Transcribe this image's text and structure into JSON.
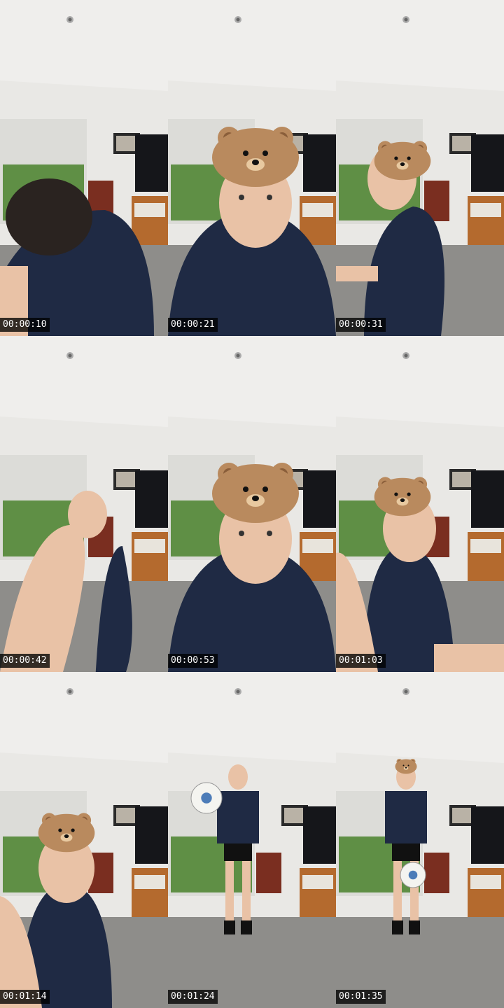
{
  "frames": [
    {
      "timestamp": "00:00:10",
      "filter": false,
      "pose": "bending"
    },
    {
      "timestamp": "00:00:21",
      "filter": true,
      "pose": "closeup"
    },
    {
      "timestamp": "00:00:31",
      "filter": true,
      "pose": "side"
    },
    {
      "timestamp": "00:00:42",
      "filter": false,
      "pose": "leg"
    },
    {
      "timestamp": "00:00:53",
      "filter": true,
      "pose": "closeup"
    },
    {
      "timestamp": "00:01:03",
      "filter": true,
      "pose": "sitting"
    },
    {
      "timestamp": "00:01:14",
      "filter": true,
      "pose": "sitting-low"
    },
    {
      "timestamp": "00:01:24",
      "filter": false,
      "pose": "juggling"
    },
    {
      "timestamp": "00:01:35",
      "filter": true,
      "pose": "juggling"
    }
  ],
  "colors": {
    "ceiling": "#efeeec",
    "wall": "#e9e8e5",
    "floor": "#8e8d8a",
    "shirt": "#1f2a44",
    "skin": "#e9c2a6",
    "hair": "#2a2320",
    "bear": "#b98a5e",
    "cabinet": "#b46a2e",
    "tv": "#15161a",
    "window_green": "#5f8f45"
  },
  "icons": [
    "ceiling-light-icon",
    "bear-filter-icon",
    "soccer-ball-icon"
  ]
}
